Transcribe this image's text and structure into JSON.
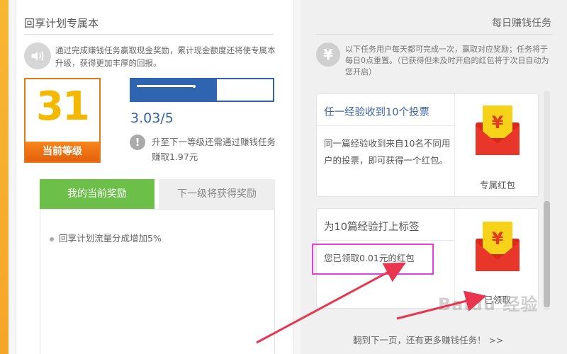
{
  "left": {
    "title": "回享计划专属本",
    "description": "通过完成赚钱任务赢取现金奖励，累计现金额度还将使专属本升级，获得更加丰厚的回报。",
    "level_number": "31",
    "level_label": "当前等级",
    "progress_text": "3.03/5",
    "progress_fraction": 0.606,
    "upgrade_info": "升至下一等级还需通过赚钱任务赚取1.97元",
    "tab_current": "我的当前奖励",
    "tab_next": "下一级将获得奖励",
    "reward_item": "回享计划流量分成增加5%"
  },
  "right": {
    "title": "每日赚钱任务",
    "description": "以下任务用户每天都可完成一次，赢取对应奖励；任务将于每日0点重置。（已获得但未及时开启的红包将于次日自动为您开启）",
    "tasks": [
      {
        "title": "任一经验收到10个投票",
        "body": "同一篇经验收到来自10名不同用户的投票，即可获得一个红包。",
        "reward_label": "专属红包"
      },
      {
        "title": "为10篇经验打上标签",
        "body": "您已领取0.01元的红包",
        "reward_label": "已领取"
      }
    ],
    "bottom_hint": "翻到下一页，还有更多赚钱任务！ >>",
    "watermark": "Baidu 经验"
  },
  "colors": {
    "orange_frame": "#f39a1e",
    "level_yellow": "#f5b800",
    "blue": "#2f64b0",
    "green_tab": "#6cc04a",
    "highlight_magenta": "#e33fe6",
    "arrow_red": "#e8364f"
  }
}
